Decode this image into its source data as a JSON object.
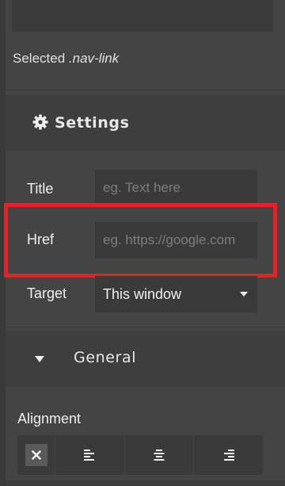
{
  "selected": {
    "prefix": "Selected",
    "class_name": ".nav-link"
  },
  "settings_section": {
    "label": "Settings",
    "icon": "gear-icon",
    "fields": {
      "title": {
        "label": "Title",
        "placeholder": "eg. Text here",
        "value": ""
      },
      "href": {
        "label": "Href",
        "placeholder": "eg. https://google.com",
        "value": ""
      },
      "target": {
        "label": "Target",
        "selected": "This window"
      }
    }
  },
  "general_section": {
    "label": "General",
    "icon": "caret-down-icon"
  },
  "alignment": {
    "label": "Alignment",
    "options": [
      {
        "name": "none",
        "icon": "close-icon",
        "active": true
      },
      {
        "name": "left",
        "icon": "align-left-icon",
        "active": false
      },
      {
        "name": "center",
        "icon": "align-center-icon",
        "active": false
      },
      {
        "name": "right",
        "icon": "align-right-icon",
        "active": false
      }
    ]
  },
  "colors": {
    "panel_bg": "#444444",
    "input_bg": "#3a3a3a",
    "highlight": "#e8202a"
  }
}
